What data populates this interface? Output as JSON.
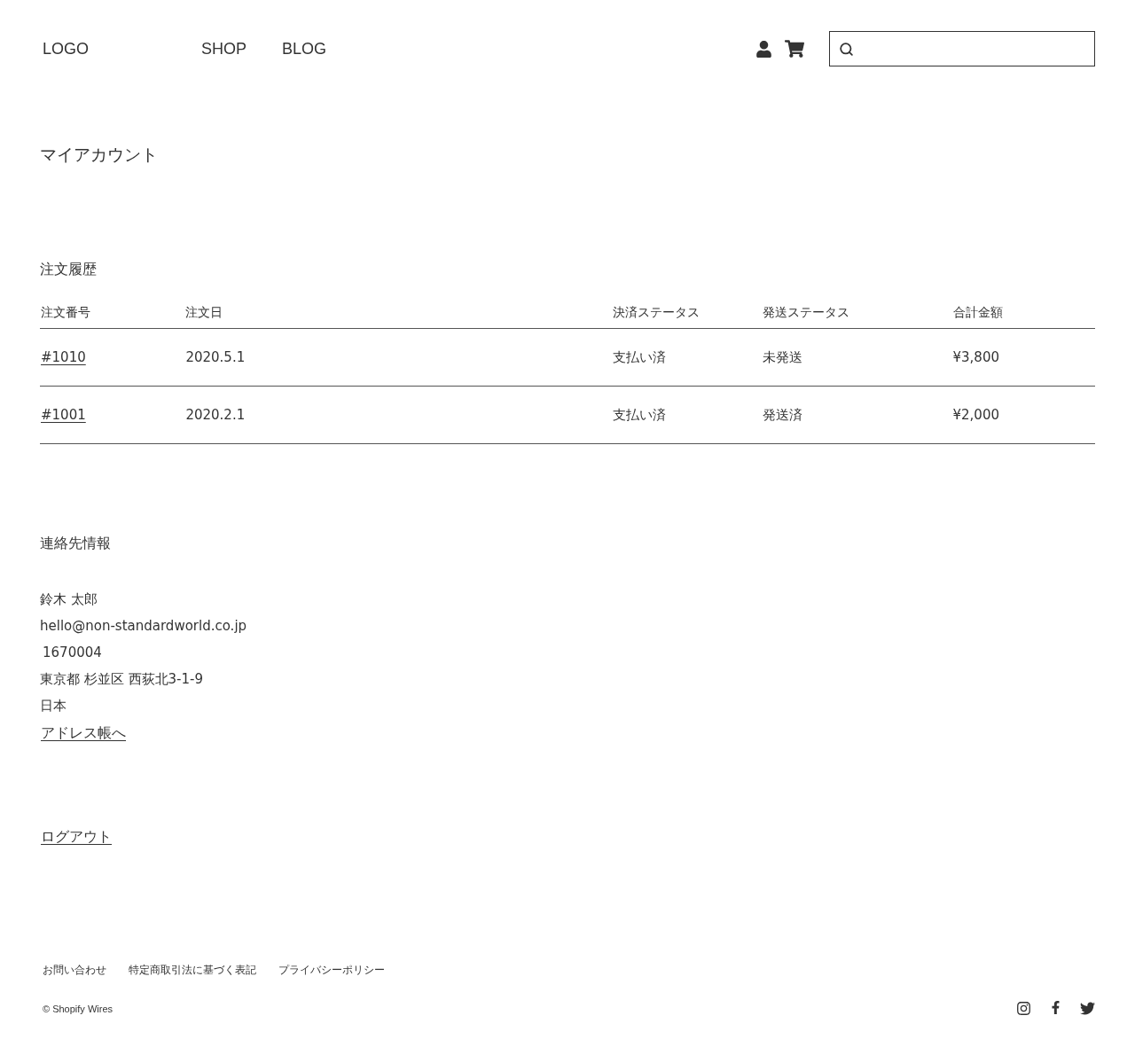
{
  "header": {
    "logo": "LOGO",
    "nav": [
      "SHOP",
      "BLOG"
    ]
  },
  "page_title": "マイアカウント",
  "orders": {
    "title": "注文履歴",
    "columns": [
      "注文番号",
      "注文日",
      "決済ステータス",
      "発送ステータス",
      "合計金額"
    ],
    "rows": [
      {
        "number": "#1010",
        "date": "2020.5.1",
        "payment": "支払い済",
        "shipping": "未発送",
        "total": "¥3,800"
      },
      {
        "number": "#1001",
        "date": "2020.2.1",
        "payment": "支払い済",
        "shipping": "発送済",
        "total": "¥2,000"
      }
    ]
  },
  "contact": {
    "title": "連絡先情報",
    "lines": [
      "鈴木 太郎",
      "hello@non-standardworld.co.jp",
      "1670004",
      "東京都 杉並区 西荻北3-1-9",
      "日本"
    ],
    "link": "アドレス帳へ"
  },
  "logout": "ログアウト",
  "footer": {
    "links": [
      "お問い合わせ",
      "特定商取引法に基づく表記",
      "プライバシーポリシー"
    ],
    "copyright": "© Shopify Wires"
  }
}
